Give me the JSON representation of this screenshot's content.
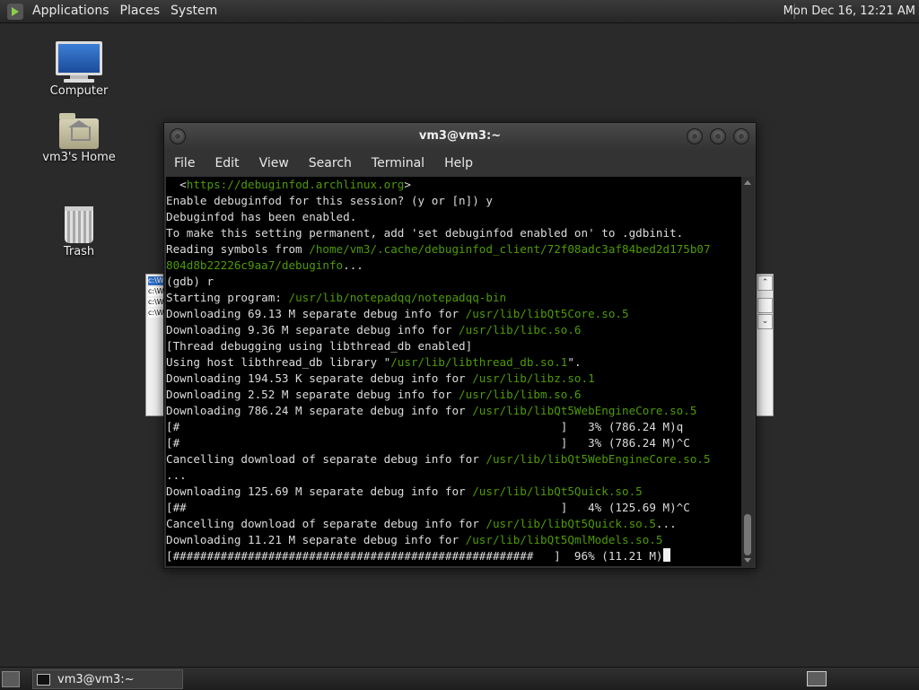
{
  "top_panel": {
    "menus": [
      "Applications",
      "Places",
      "System"
    ],
    "clock": "Mon Dec 16, 12:21 AM"
  },
  "desktop": {
    "icons": [
      {
        "label": "Computer",
        "icon": "computer-icon"
      },
      {
        "label": "vm3's Home",
        "icon": "home-folder-icon"
      },
      {
        "label": "Trash",
        "icon": "trash-icon"
      }
    ]
  },
  "background_window": {
    "rows": [
      "c:\\W",
      "c:\\W",
      "c:\\W",
      "c:\\W"
    ]
  },
  "terminal": {
    "title": "vm3@vm3:~",
    "menu": [
      "File",
      "Edit",
      "View",
      "Search",
      "Terminal",
      "Help"
    ],
    "lines": [
      [
        {
          "t": "  <"
        },
        {
          "t": "https://debuginfod.archlinux.org",
          "p": true
        },
        {
          "t": ">"
        }
      ],
      [
        {
          "t": "Enable debuginfod for this session? (y or [n]) y"
        }
      ],
      [
        {
          "t": "Debuginfod has been enabled."
        }
      ],
      [
        {
          "t": "To make this setting permanent, add 'set debuginfod enabled on' to .gdbinit."
        }
      ],
      [
        {
          "t": "Reading symbols from "
        },
        {
          "t": "/home/vm3/.cache/debuginfod_client/72f08adc3af84bed2d175b07",
          "p": true
        }
      ],
      [
        {
          "t": "804d8b22226c9aa7/debuginfo",
          "p": true
        },
        {
          "t": "..."
        }
      ],
      [
        {
          "t": "(gdb) r"
        }
      ],
      [
        {
          "t": "Starting program: "
        },
        {
          "t": "/usr/lib/notepadqq/notepadqq-bin",
          "p": true
        }
      ],
      [
        {
          "t": "Downloading 69.13 M separate debug info for "
        },
        {
          "t": "/usr/lib/libQt5Core.so.5",
          "p": true
        }
      ],
      [
        {
          "t": "Downloading 9.36 M separate debug info for "
        },
        {
          "t": "/usr/lib/libc.so.6",
          "p": true
        }
      ],
      [
        {
          "t": "[Thread debugging using libthread_db enabled]"
        }
      ],
      [
        {
          "t": "Using host libthread_db library \""
        },
        {
          "t": "/usr/lib/libthread_db.so.1",
          "p": true
        },
        {
          "t": "\"."
        }
      ],
      [
        {
          "t": "Downloading 194.53 K separate debug info for "
        },
        {
          "t": "/usr/lib/libz.so.1",
          "p": true
        }
      ],
      [
        {
          "t": "Downloading 2.52 M separate debug info for "
        },
        {
          "t": "/usr/lib/libm.so.6",
          "p": true
        }
      ],
      [
        {
          "t": "Downloading 786.24 M separate debug info for "
        },
        {
          "t": "/usr/lib/libQt5WebEngineCore.so.5",
          "p": true
        }
      ],
      [
        {
          "t": "[#                                                        ]   3% (786.24 M)q"
        }
      ],
      [
        {
          "t": "[#                                                        ]   3% (786.24 M)^C"
        }
      ],
      [
        {
          "t": "Cancelling download of separate debug info for "
        },
        {
          "t": "/usr/lib/libQt5WebEngineCore.so.5",
          "p": true
        }
      ],
      [
        {
          "t": "..."
        }
      ],
      [
        {
          "t": "Downloading 125.69 M separate debug info for "
        },
        {
          "t": "/usr/lib/libQt5Quick.so.5",
          "p": true
        }
      ],
      [
        {
          "t": "[##                                                       ]   4% (125.69 M)^C"
        }
      ],
      [
        {
          "t": "Cancelling download of separate debug info for "
        },
        {
          "t": "/usr/lib/libQt5Quick.so.5",
          "p": true
        },
        {
          "t": "..."
        }
      ],
      [
        {
          "t": "Downloading 11.21 M separate debug info for "
        },
        {
          "t": "/usr/lib/libQt5QmlModels.so.5",
          "p": true
        }
      ],
      [
        {
          "t": "[#####################################################   ]  96% (11.21 M)"
        },
        {
          "cursor": true
        }
      ]
    ]
  },
  "taskbar": {
    "task_label": "vm3@vm3:~"
  },
  "colors": {
    "path_green": "#4e9a06",
    "terminal_bg": "#000000",
    "desktop_bg": "#2a2a2a"
  }
}
